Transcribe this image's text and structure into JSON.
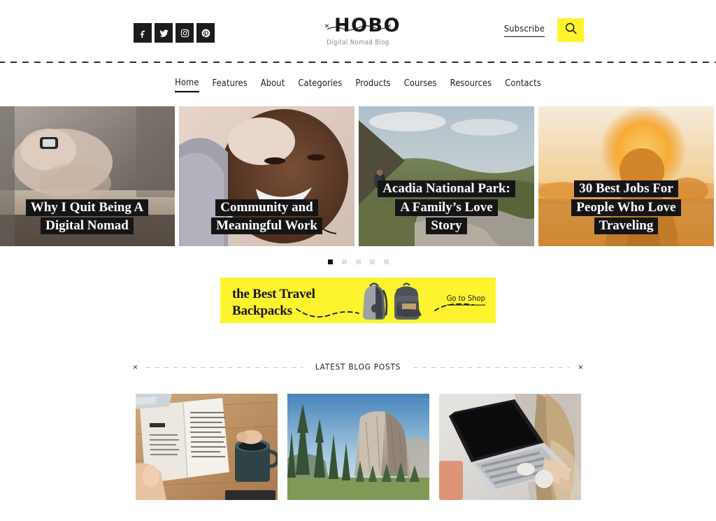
{
  "site": {
    "logo_text": "HOBO",
    "logo_tagline": "Digital Nomad Blog",
    "logo_x_left": "×",
    "logo_x_right": "×",
    "accent_yellow": "#fff22d",
    "promo_yellow": "#fdf32e",
    "ink": "#151515"
  },
  "header": {
    "social": [
      {
        "name": "facebook",
        "label": "Facebook"
      },
      {
        "name": "twitter",
        "label": "Twitter"
      },
      {
        "name": "instagram",
        "label": "Instagram"
      },
      {
        "name": "pinterest",
        "label": "Pinterest"
      }
    ],
    "subscribe_label": "Subscribe",
    "search_label": "Search"
  },
  "nav": {
    "items": [
      {
        "label": "Home",
        "active": true
      },
      {
        "label": "Features",
        "active": false
      },
      {
        "label": "About",
        "active": false
      },
      {
        "label": "Categories",
        "active": false
      },
      {
        "label": "Products",
        "active": false
      },
      {
        "label": "Courses",
        "active": false
      },
      {
        "label": "Resources",
        "active": false
      },
      {
        "label": "Contacts",
        "active": false
      }
    ]
  },
  "hero": {
    "slides": [
      {
        "title_lines": [
          "Why I Quit Being A",
          "Digital Nomad"
        ],
        "image_alt": "hand-on-laptop-close-up"
      },
      {
        "title_lines": [
          "Community and",
          "Meaningful Work"
        ],
        "image_alt": "smiling-woman-portrait"
      },
      {
        "title_lines": [
          "Acadia National Park:",
          "A Family’s Love",
          "Story"
        ],
        "image_alt": "hiker-on-rocky-green-valley"
      },
      {
        "title_lines": [
          "30 Best Jobs For",
          "People Who Love",
          "Traveling"
        ],
        "image_alt": "silhouette-person-at-sunset"
      }
    ],
    "dots": [
      {
        "active": true
      },
      {
        "active": false
      },
      {
        "active": false
      },
      {
        "active": false
      },
      {
        "active": false
      }
    ]
  },
  "promo": {
    "title_line1": "the Best Travel",
    "title_line2": "Backpacks",
    "cta_label": "Go to Shop",
    "image_alt": "two-gray-travel-backpacks"
  },
  "latest": {
    "divider_x_left": "×",
    "divider_x_right": "×",
    "section_title": "LATEST BLOG POSTS",
    "posts": [
      {
        "image_alt": "open-book-and-coffee-mug-on-wooden-table"
      },
      {
        "image_alt": "el-capitan-yosemite-valley-pine-trees"
      },
      {
        "image_alt": "hands-typing-on-laptop-overhead"
      }
    ]
  }
}
